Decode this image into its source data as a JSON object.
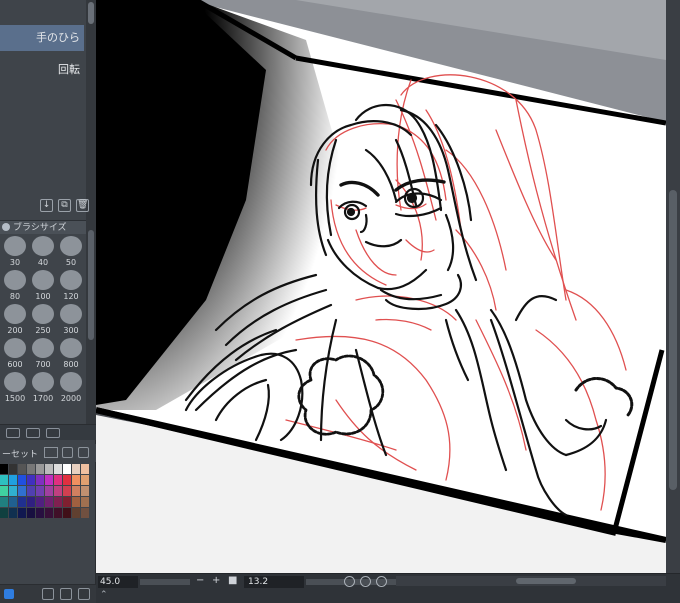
{
  "subtool": {
    "palm_label": "手のひら",
    "rotate_label": "回転"
  },
  "brush_size": {
    "title": "ブラシサイズ",
    "sizes": [
      "30",
      "40",
      "50",
      "80",
      "100",
      "120",
      "200",
      "250",
      "300",
      "600",
      "700",
      "800",
      "1500",
      "1700",
      "2000"
    ]
  },
  "palette": {
    "set_label": "ーセット"
  },
  "status": {
    "zoom": "45.0",
    "rotation": "13.2",
    "minus": "−",
    "plus": "+"
  },
  "colors": {
    "panel": "#3f444a",
    "selected": "#5a6f8c",
    "line_art": "#111111",
    "rough": "#e05050"
  }
}
